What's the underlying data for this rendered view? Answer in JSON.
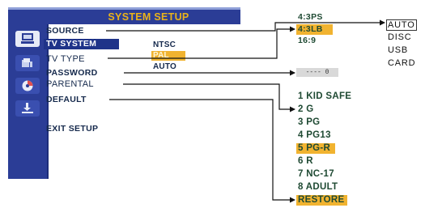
{
  "window": {
    "title": "SYSTEM SETUP"
  },
  "icons": [
    {
      "name": "monitor-icon",
      "selected": true
    },
    {
      "name": "speaker-icon",
      "selected": false
    },
    {
      "name": "disc-icon",
      "selected": false
    },
    {
      "name": "download-icon",
      "selected": false
    }
  ],
  "menu": {
    "source": "SOURCE",
    "tv_system": "TV SYSTEM",
    "tv_type": "TV TYPE",
    "password": "PASSWORD",
    "parental": "PARENTAL",
    "default": "DEFAULT",
    "exit": "EXIT SETUP"
  },
  "tv_system_options": [
    "NTSC",
    "PAL",
    "AUTO"
  ],
  "tv_system_selected": "PAL",
  "tv_type_options": [
    "4:3PS",
    "4:3LB",
    "16:9"
  ],
  "tv_type_selected": "4:3LB",
  "source_options": [
    "AUTO",
    "DISC",
    "USB",
    "CARD"
  ],
  "source_selected": "AUTO",
  "password_value": "---- 0",
  "parental_options": [
    "1 KID SAFE",
    "2 G",
    "3 PG",
    "4 PG13",
    "5 PG-R",
    "6 R",
    "7 NC-17",
    "8 ADULT"
  ],
  "parental_selected": "5 PG-R",
  "default_option": "RESTORE",
  "colors": {
    "osd_blue": "#2b3d96",
    "title_gold": "#e9b21a",
    "highlight": "#f1b330"
  }
}
